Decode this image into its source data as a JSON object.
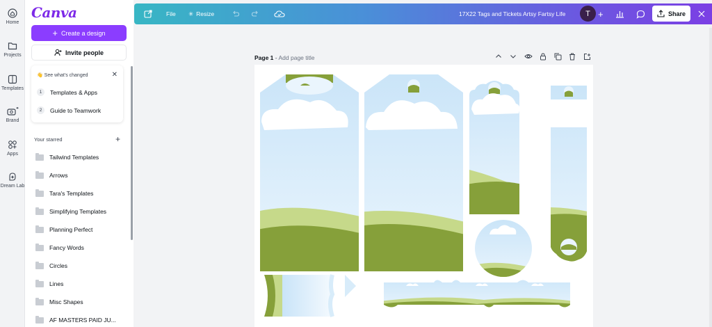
{
  "rail": {
    "items": [
      {
        "label": "Home",
        "icon": "home-icon"
      },
      {
        "label": "Projects",
        "icon": "folder-icon"
      },
      {
        "label": "Templates",
        "icon": "templates-icon"
      },
      {
        "label": "Brand",
        "icon": "brand-icon"
      },
      {
        "label": "Apps",
        "icon": "apps-icon"
      },
      {
        "label": "Dream Lab",
        "icon": "dream-lab-icon"
      }
    ]
  },
  "panel": {
    "logo": "Canva",
    "create_label": "Create a design",
    "invite_label": "Invite people",
    "changes": {
      "title": "See what's changed",
      "close": "✕",
      "items": [
        {
          "num": "1",
          "label": "Templates & Apps"
        },
        {
          "num": "2",
          "label": "Guide to Teamwork"
        }
      ]
    },
    "starred_title": "Your starred",
    "starred_add": "+",
    "folders": [
      "Tailwind Templates",
      "Arrows",
      "Tara's Templates",
      "Simplifying Templates",
      "Planning Perfect",
      "Fancy Words",
      "Circles",
      "Lines",
      "Misc Shapes",
      "AF MASTERS PAID JU..."
    ]
  },
  "topbar": {
    "file_label": "File",
    "resize_label": "Resize",
    "doc_title": "17X22 Tags and Tickets Artsy Fartsy Life",
    "avatar_initial": "T",
    "share_label": "Share"
  },
  "page": {
    "label": "Page 1",
    "separator": " - ",
    "title_placeholder": "Add page title"
  },
  "colors": {
    "brand": "#8b3dff",
    "sky": "#d8ecfa",
    "grass_light": "#c6d98a",
    "grass_dark": "#86a03a"
  }
}
